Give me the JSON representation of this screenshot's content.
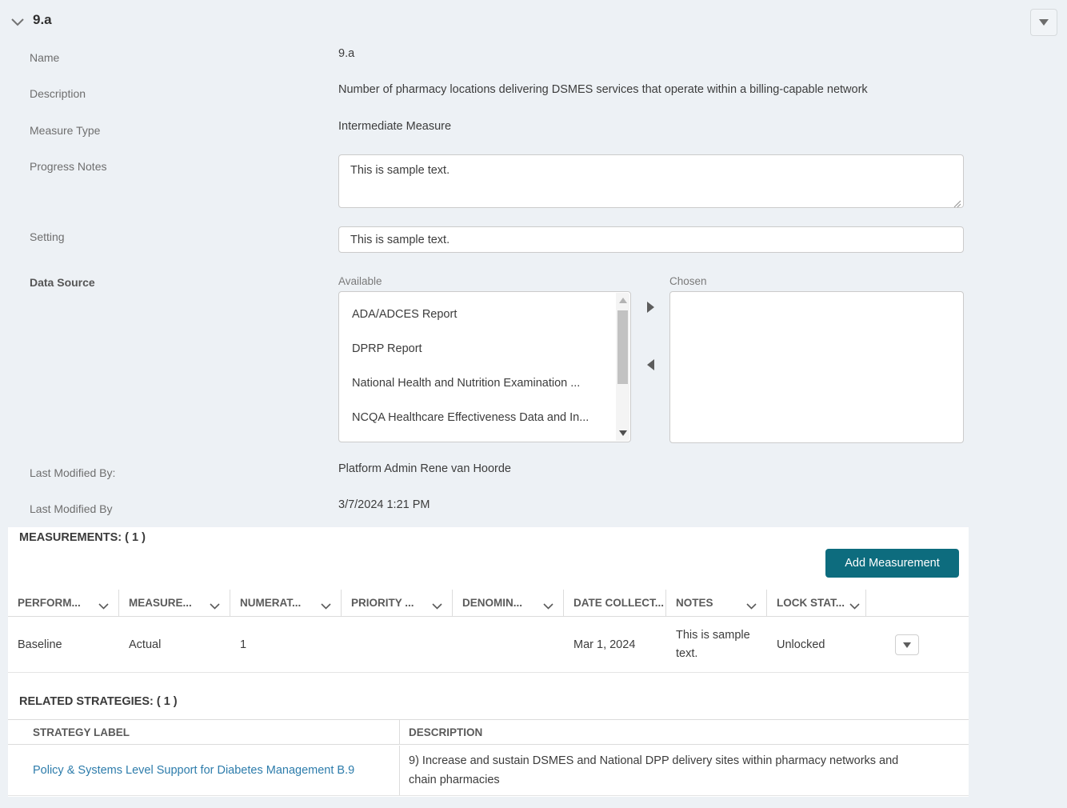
{
  "header": {
    "title": "9.a"
  },
  "form": {
    "labels": {
      "name": "Name",
      "description": "Description",
      "measure_type": "Measure Type",
      "progress_notes": "Progress Notes",
      "setting": "Setting",
      "data_source": "Data Source",
      "last_modified_by": "Last Modified By:",
      "last_modified_date": "Last Modified By"
    },
    "values": {
      "name": "9.a",
      "description": "Number of pharmacy locations delivering DSMES services that operate within a billing-capable network",
      "measure_type": "Intermediate Measure",
      "progress_notes": "This is sample text.",
      "setting": "This is sample text.",
      "last_modified_by": "Platform Admin Rene van Hoorde",
      "last_modified_date": "3/7/2024 1:21 PM"
    },
    "data_source": {
      "available_label": "Available",
      "chosen_label": "Chosen",
      "available_items": [
        "ADA/ADCES Report",
        "DPRP Report",
        "National Health and Nutrition Examination ...",
        "NCQA Healthcare Effectiveness Data and In..."
      ],
      "chosen_items": []
    }
  },
  "measurements": {
    "title": "MEASUREMENTS: ( 1 )",
    "add_button_label": "Add Measurement",
    "columns": [
      "PERFORM...",
      "MEASURE...",
      "NUMERAT...",
      "PRIORITY ...",
      "DENOMIN...",
      "DATE COLLECT...",
      "NOTES",
      "LOCK STAT..."
    ],
    "row": {
      "performance": "Baseline",
      "measure": "Actual",
      "numerator": "1",
      "priority": "",
      "denominator": "",
      "date_collected": "Mar 1, 2024",
      "notes": "This is sample text.",
      "lock_status": "Unlocked"
    }
  },
  "related_strategies": {
    "title": "RELATED STRATEGIES: ( 1 )",
    "columns": {
      "strategy_label": "STRATEGY LABEL",
      "description": "DESCRIPTION"
    },
    "row": {
      "strategy_label": "Policy & Systems Level Support for Diabetes Management B.9",
      "description": "9) Increase and sustain DSMES and National DPP delivery sites within pharmacy networks and chain pharmacies"
    }
  },
  "colors": {
    "accent_teal": "#0d6c7e",
    "link_blue": "#2d7cab",
    "page_background": "#edf1f5"
  }
}
